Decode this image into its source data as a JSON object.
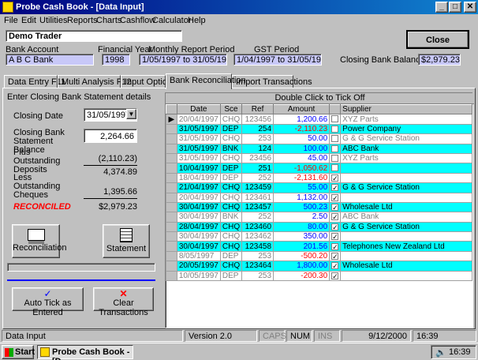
{
  "window": {
    "title": "Probe Cash Book - [Data Input]"
  },
  "menu": [
    "File",
    "Edit",
    "Utilities",
    "Reports",
    "Charts",
    "Cashflow",
    "Calculator",
    "Help"
  ],
  "header": {
    "company": "Demo Trader",
    "close_label": "Close",
    "bank_account_label": "Bank Account",
    "bank_account": "A B C Bank",
    "financial_year_label": "Financial Year",
    "financial_year": "1998",
    "monthly_period_label": "Monthly Report Period",
    "monthly_period": "1/05/1997 to 31/05/1997",
    "gst_period_label": "GST Period",
    "gst_period": "1/04/1997 to 31/05/1997",
    "closing_balance_label": "Closing Bank Balance",
    "closing_balance": "$2,979.23"
  },
  "tabs": [
    "Data Entry  F11",
    "Multi Analysis  F12",
    "Input Options",
    "Bank Reconciliation",
    "Import Transactions"
  ],
  "recon": {
    "heading": "Enter Closing Bank Statement details",
    "closing_date_label": "Closing Date",
    "closing_date": "31/05/1997",
    "statement_balance_label": "Closing Bank Statement Balance",
    "statement_balance": "2,264.66",
    "outstanding_deposits_label": "Plus Outstanding Deposits",
    "outstanding_deposits": "(2,110.23)",
    "subtotal": "4,374.89",
    "outstanding_cheques_label": "Less Outstanding Cheques",
    "outstanding_cheques": "1,395.66",
    "reconciled_label": "RECONCILED",
    "reconciled_value": "$2,979.23",
    "reconciliation_button": "Reconciliation",
    "statement_button": "Statement",
    "auto_tick_button": "Auto Tick as Entered",
    "clear_button": "Clear Transactions"
  },
  "grid": {
    "title": "Double Click to Tick Off",
    "columns": [
      "Date",
      "Sce",
      "Ref",
      "Amount",
      "",
      "Supplier"
    ],
    "rows": [
      {
        "date": "20/04/1997",
        "sce": "CHQ",
        "ref": "123456",
        "amount": "1,200.66",
        "ticked": false,
        "supplier": "XYZ Parts",
        "style": "white",
        "dim": true,
        "neg": false,
        "current": true
      },
      {
        "date": "31/05/1997",
        "sce": "DEP",
        "ref": "254",
        "amount": "-2,110.23",
        "ticked": false,
        "supplier": "Power Company",
        "style": "cyan",
        "dim": false,
        "neg": true
      },
      {
        "date": "31/05/1997",
        "sce": "CHQ",
        "ref": "253",
        "amount": "50.00",
        "ticked": false,
        "supplier": "G & G Service Station",
        "style": "white",
        "dim": true,
        "neg": false
      },
      {
        "date": "31/05/1997",
        "sce": "BNK",
        "ref": "124",
        "amount": "100.00",
        "ticked": false,
        "supplier": "ABC Bank",
        "style": "cyan",
        "dim": false,
        "neg": false
      },
      {
        "date": "31/05/1997",
        "sce": "CHQ",
        "ref": "23456",
        "amount": "45.00",
        "ticked": false,
        "supplier": "XYZ Parts",
        "style": "white",
        "dim": true,
        "neg": false
      },
      {
        "date": "10/04/1997",
        "sce": "DEP",
        "ref": "251",
        "amount": "-1,050.62",
        "ticked": false,
        "supplier": "",
        "style": "cyan",
        "dim": false,
        "neg": true
      },
      {
        "date": "18/04/1997",
        "sce": "DEP",
        "ref": "252",
        "amount": "-2,131.60",
        "ticked": true,
        "supplier": "",
        "style": "white",
        "dim": true,
        "neg": true
      },
      {
        "date": "21/04/1997",
        "sce": "CHQ",
        "ref": "123459",
        "amount": "55.00",
        "ticked": true,
        "supplier": "G & G Service Station",
        "style": "cyan",
        "dim": false,
        "neg": false
      },
      {
        "date": "20/04/1997",
        "sce": "CHQ",
        "ref": "123461",
        "amount": "1,132.00",
        "ticked": true,
        "supplier": "",
        "style": "white",
        "dim": true,
        "neg": false
      },
      {
        "date": "30/04/1997",
        "sce": "CHQ",
        "ref": "123457",
        "amount": "500.23",
        "ticked": true,
        "supplier": "Wholesale  Ltd",
        "style": "cyan",
        "dim": false,
        "neg": false
      },
      {
        "date": "30/04/1997",
        "sce": "BNK",
        "ref": "252",
        "amount": "2.50",
        "ticked": true,
        "supplier": "ABC Bank",
        "style": "white",
        "dim": true,
        "neg": false
      },
      {
        "date": "28/04/1997",
        "sce": "CHQ",
        "ref": "123460",
        "amount": "80.00",
        "ticked": true,
        "supplier": "G & G Service Station",
        "style": "cyan",
        "dim": false,
        "neg": false
      },
      {
        "date": "30/04/1997",
        "sce": "CHQ",
        "ref": "123462",
        "amount": "350.00",
        "ticked": true,
        "supplier": "",
        "style": "white",
        "dim": true,
        "neg": false
      },
      {
        "date": "30/04/1997",
        "sce": "CHQ",
        "ref": "123458",
        "amount": "201.56",
        "ticked": true,
        "supplier": "Telephones New Zealand Ltd",
        "style": "cyan",
        "dim": false,
        "neg": false
      },
      {
        "date": "8/05/1997",
        "sce": "DEP",
        "ref": "253",
        "amount": "-500.20",
        "ticked": true,
        "supplier": "",
        "style": "white",
        "dim": true,
        "neg": true
      },
      {
        "date": "20/05/1997",
        "sce": "CHQ",
        "ref": "123464",
        "amount": "1,800.00",
        "ticked": true,
        "supplier": "Wholesale  Ltd",
        "style": "cyan",
        "dim": false,
        "neg": false
      },
      {
        "date": "10/05/1997",
        "sce": "DEP",
        "ref": "253",
        "amount": "-200.30",
        "ticked": true,
        "supplier": "",
        "style": "white",
        "dim": true,
        "neg": true
      }
    ]
  },
  "status": {
    "mode": "Data Input",
    "version": "Version 2.0",
    "caps": "CAPS",
    "num": "NUM",
    "ins": "INS",
    "date": "9/12/2000",
    "time": "16:39"
  },
  "taskbar": {
    "start": "Start",
    "task": "Probe Cash Book - [D...",
    "clock": "16:39"
  }
}
